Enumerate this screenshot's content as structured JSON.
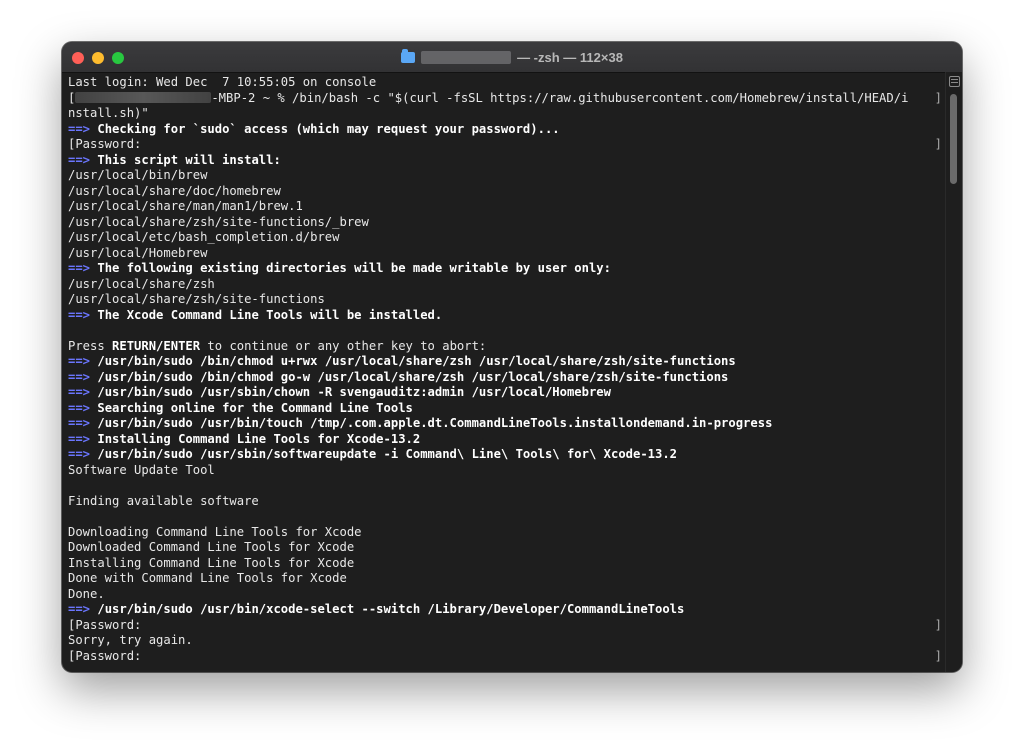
{
  "window": {
    "title": "— -zsh — 112×38",
    "icon": "folder-icon"
  },
  "colors": {
    "arrow": "#6b76ff",
    "background": "#1e1e1e",
    "text": "#e8e8e8"
  },
  "terminal": {
    "lines": [
      {
        "t": "plain",
        "text": "Last login: Wed Dec  7 10:55:05 on console"
      },
      {
        "t": "prompt",
        "bracket_left": "[",
        "suffix": "-MBP-2 ~ % /bin/bash -c \"$(curl -fsSL https://raw.githubusercontent.com/Homebrew/install/HEAD/i",
        "bracket_right": "]"
      },
      {
        "t": "plain",
        "text": "nstall.sh)\""
      },
      {
        "t": "arrow",
        "arrow": "==>",
        "text": " Checking for `sudo` access (which may request your password)..."
      },
      {
        "t": "bracketed",
        "text": "[Password:",
        "bracket_right": "]"
      },
      {
        "t": "arrow",
        "arrow": "==>",
        "text": " This script will install:"
      },
      {
        "t": "plain",
        "text": "/usr/local/bin/brew"
      },
      {
        "t": "plain",
        "text": "/usr/local/share/doc/homebrew"
      },
      {
        "t": "plain",
        "text": "/usr/local/share/man/man1/brew.1"
      },
      {
        "t": "plain",
        "text": "/usr/local/share/zsh/site-functions/_brew"
      },
      {
        "t": "plain",
        "text": "/usr/local/etc/bash_completion.d/brew"
      },
      {
        "t": "plain",
        "text": "/usr/local/Homebrew"
      },
      {
        "t": "arrow",
        "arrow": "==>",
        "text": " The following existing directories will be made writable by user only:"
      },
      {
        "t": "plain",
        "text": "/usr/local/share/zsh"
      },
      {
        "t": "plain",
        "text": "/usr/local/share/zsh/site-functions"
      },
      {
        "t": "arrow",
        "arrow": "==>",
        "text": " The Xcode Command Line Tools will be installed."
      },
      {
        "t": "plain",
        "text": ""
      },
      {
        "t": "press",
        "pre": "Press ",
        "bold": "RETURN/ENTER",
        "post": " to continue or any other key to abort:"
      },
      {
        "t": "arrow",
        "arrow": "==>",
        "text": " /usr/bin/sudo /bin/chmod u+rwx /usr/local/share/zsh /usr/local/share/zsh/site-functions"
      },
      {
        "t": "arrow",
        "arrow": "==>",
        "text": " /usr/bin/sudo /bin/chmod go-w /usr/local/share/zsh /usr/local/share/zsh/site-functions"
      },
      {
        "t": "arrow",
        "arrow": "==>",
        "text": " /usr/bin/sudo /usr/sbin/chown -R svengauditz:admin /usr/local/Homebrew"
      },
      {
        "t": "arrow",
        "arrow": "==>",
        "text": " Searching online for the Command Line Tools"
      },
      {
        "t": "arrow",
        "arrow": "==>",
        "text": " /usr/bin/sudo /usr/bin/touch /tmp/.com.apple.dt.CommandLineTools.installondemand.in-progress"
      },
      {
        "t": "arrow",
        "arrow": "==>",
        "text": " Installing Command Line Tools for Xcode-13.2"
      },
      {
        "t": "arrow",
        "arrow": "==>",
        "text": " /usr/bin/sudo /usr/sbin/softwareupdate -i Command\\ Line\\ Tools\\ for\\ Xcode-13.2"
      },
      {
        "t": "plain",
        "text": "Software Update Tool"
      },
      {
        "t": "plain",
        "text": ""
      },
      {
        "t": "plain",
        "text": "Finding available software"
      },
      {
        "t": "plain",
        "text": ""
      },
      {
        "t": "plain",
        "text": "Downloading Command Line Tools for Xcode"
      },
      {
        "t": "plain",
        "text": "Downloaded Command Line Tools for Xcode"
      },
      {
        "t": "plain",
        "text": "Installing Command Line Tools for Xcode"
      },
      {
        "t": "plain",
        "text": "Done with Command Line Tools for Xcode"
      },
      {
        "t": "plain",
        "text": "Done."
      },
      {
        "t": "arrow",
        "arrow": "==>",
        "text": " /usr/bin/sudo /usr/bin/xcode-select --switch /Library/Developer/CommandLineTools"
      },
      {
        "t": "bracketed",
        "text": "[Password:",
        "bracket_right": "]"
      },
      {
        "t": "plain",
        "text": "Sorry, try again."
      },
      {
        "t": "bracketed",
        "text": "[Password:",
        "bracket_right": "]"
      }
    ]
  }
}
